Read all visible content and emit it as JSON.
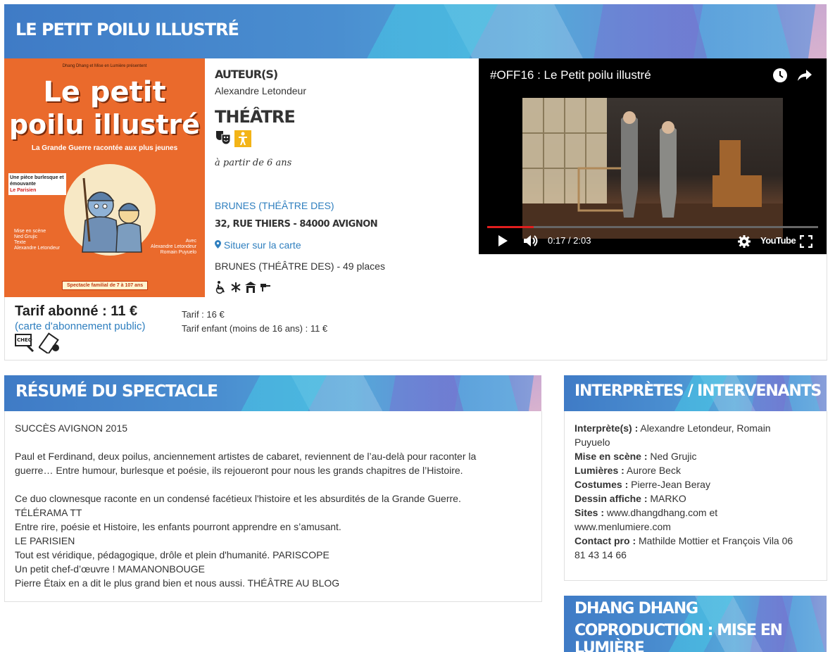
{
  "page_title": "LE PETIT POILU ILLUSTRÉ",
  "poster": {
    "presenter": "Dhang Dhang et Mise en Lumière présentent",
    "title_line1": "Le petit",
    "title_line2": "poilu illustré",
    "subtitle": "La Grande Guerre racontée aux plus jeunes",
    "badge_text": "Une pièce burlesque et émouvante",
    "badge_source": "Le Parisien",
    "credits_left": [
      "Mise en scène",
      "Ned Grujic",
      "Texte",
      "Alexandre Letondeur"
    ],
    "credits_right": [
      "Avec",
      "Alexandre Letondeur",
      "Romain Puyuelo"
    ],
    "footer": "Spectacle familial de 7 à 107 ans"
  },
  "info": {
    "authors_label": "AUTEUR(S)",
    "authors_value": "Alexandre Letondeur",
    "genre": "THÉÂTRE",
    "age": "à partir de 6 ans",
    "venue_link": "BRUNES (THÉÂTRE DES)",
    "address": "32, RUE THIERS - 84000 AVIGNON",
    "map_link": "Situer sur la carte",
    "capacity": "BRUNES (THÉÂTRE DES) - 49 places"
  },
  "pricing": {
    "subscriber": "Tarif abonné : 11 €",
    "card_open": "(",
    "card_link": "carte d'abonnement public",
    "card_close": ")",
    "normal": "Tarif : 16 €",
    "child": "Tarif enfant (moins de 16 ans) : 11 €"
  },
  "video": {
    "title": "#OFF16 : Le Petit poilu illustré",
    "time": "0:17 / 2:03",
    "progress": 0.14,
    "brand": "YouTube"
  },
  "summary": {
    "heading": "RÉSUMÉ DU SPECTACLE",
    "lines": [
      "SUCCÈS AVIGNON 2015",
      "",
      "Paul et Ferdinand, deux poilus, anciennement artistes de cabaret, reviennent de l’au-delà pour raconter la",
      "guerre… Entre humour, burlesque et poésie, ils rejoueront pour nous les grands chapitres de l’Histoire.",
      "",
      "Ce duo clownesque raconte en un condensé facétieux l'histoire et les absurdités de la Grande Guerre.",
      "TÉLÉRAMA TT",
      "Entre rire, poésie et Histoire, les enfants pourront apprendre en s’amusant.",
      "LE PARISIEN",
      "Tout est véridique, pédagogique, drôle et plein d'humanité. PARISCOPE",
      "Un petit chef-d’œuvre ! MAMANONBOUGE",
      "Pierre Étaix en a dit le plus grand bien et nous aussi. THÉÂTRE AU BLOG"
    ]
  },
  "cast": {
    "heading": "INTERPRÈTES / INTERVENANTS",
    "rows": [
      {
        "label": "Interprète(s) :",
        "value": " Alexandre Letondeur, Romain",
        "value2": "Puyuelo"
      },
      {
        "label": "Mise en scène :",
        "value": " Ned Grujic"
      },
      {
        "label": "Lumières :",
        "value": " Aurore Beck"
      },
      {
        "label": "Costumes :",
        "value": " Pierre-Jean Beray"
      },
      {
        "label": "Dessin affiche :",
        "value": " MARKO"
      },
      {
        "label": "Sites :",
        "value": " www.dhangdhang.com et",
        "value2": "www.menlumiere.com"
      },
      {
        "label": "Contact pro :",
        "value": " Mathilde Mottier et François Vila 06",
        "value2": "81 43 14 66"
      }
    ]
  },
  "company": {
    "line1": "DHANG DHANG",
    "line2": "COPRODUCTION : MISE EN LUMIÈRE"
  },
  "colors": {
    "banner": "#3f7bc6",
    "link": "#2f7fbf",
    "poster_orange": "#ea6a2c",
    "icon_yellow": "#f3b417",
    "progress_red": "#e01e1e"
  },
  "icons": [
    "theatre-masks-icon",
    "child-icon",
    "wheelchair-icon",
    "snowflake-icon",
    "building-icon",
    "parking-icon",
    "map-marker-icon",
    "cheque-icon",
    "ticket-icon",
    "clock-icon",
    "share-icon",
    "play-icon",
    "volume-icon",
    "settings-icon",
    "fullscreen-icon"
  ]
}
